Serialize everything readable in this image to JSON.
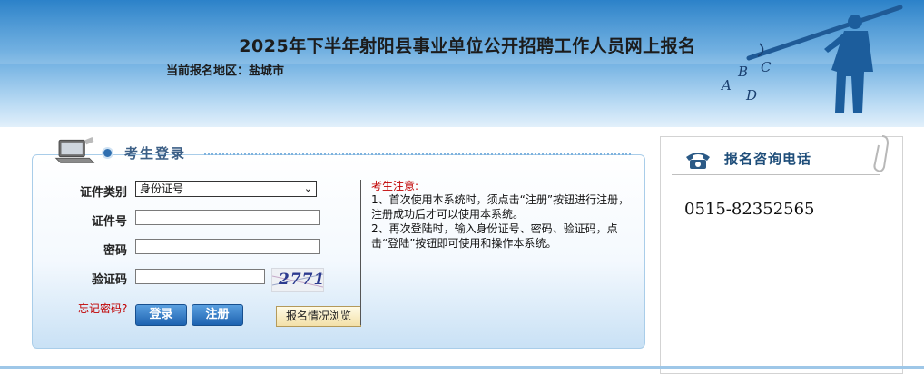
{
  "header": {
    "title": "2025年下半年射阳县事业单位公开招聘工作人员网上报名",
    "region_label": "当前报名地区：盐城市",
    "mascot_letters": [
      "A",
      "B",
      "C",
      "D"
    ]
  },
  "login": {
    "section_title": "考生登录",
    "id_type_label": "证件类别",
    "id_type_selected": "身份证号",
    "id_number_label": "证件号",
    "id_number_value": "",
    "password_label": "密码",
    "password_value": "",
    "captcha_label": "验证码",
    "captcha_value": "",
    "captcha_text": "2771",
    "forgot_password": "忘记密码?",
    "login_button": "登录",
    "register_button": "注册",
    "browse_button": "报名情况浏览"
  },
  "notice": {
    "title": "考生注意:",
    "line1": "1、首次使用本系统时，须点击“注册”按钮进行注册，注册成功后才可以使用本系统。",
    "line2": "2、再次登陆时，输入身份证号、密码、验证码，点击“登陆”按钮即可使用和操作本系统。"
  },
  "contact": {
    "title": "报名咨询电话",
    "phone": "0515-82352565"
  },
  "colors": {
    "header_top": "#2c82c9",
    "notice_red": "#c00000",
    "button_blue": "#1d62b0"
  }
}
